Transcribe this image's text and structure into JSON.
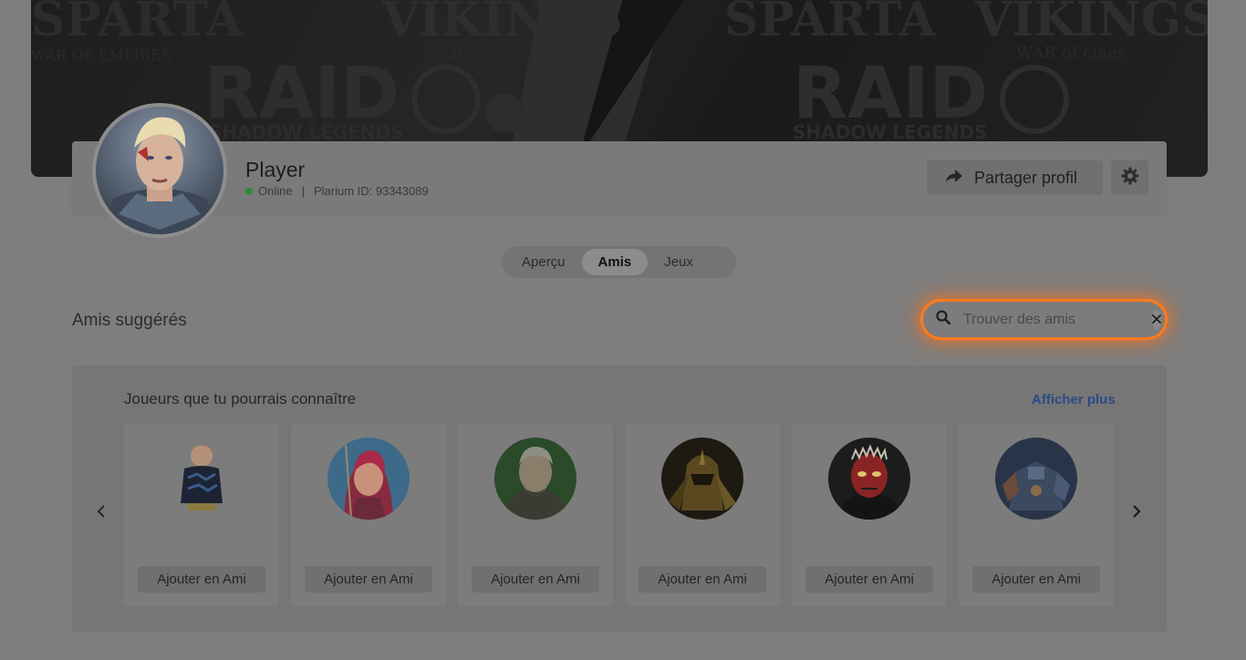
{
  "banner": {
    "texts": [
      "SPARTA",
      "VIKINGS",
      "RAID",
      "SHADOW LEGENDS",
      "WAR OF EMPIRES",
      "WAR of clans"
    ]
  },
  "profile": {
    "name": "Player",
    "status": "Online",
    "separator": "|",
    "id_label": "Plarium ID: 93343089",
    "share_label": "Partager profil",
    "share_icon": "share-arrow-icon",
    "settings_icon": "gear-icon"
  },
  "tabs": [
    {
      "label": "Aperçu",
      "active": false
    },
    {
      "label": "Amis",
      "active": true
    },
    {
      "label": "Jeux",
      "active": false
    }
  ],
  "section": {
    "title": "Amis suggérés"
  },
  "search": {
    "placeholder": "Trouver des amis",
    "value": "",
    "icon": "search-icon",
    "clear_icon": "close-icon",
    "highlight_color": "#ff7a1a"
  },
  "suggestions": {
    "title": "Joueurs que tu pourrais connaître",
    "show_more": "Afficher plus",
    "prev_icon": "chevron-left-icon",
    "next_icon": "chevron-right-icon",
    "cards": [
      {
        "avatar": "child-sweater-avatar",
        "button": "Ajouter en Ami"
      },
      {
        "avatar": "pink-hair-warrior-avatar",
        "button": "Ajouter en Ami"
      },
      {
        "avatar": "old-bearded-man-avatar",
        "button": "Ajouter en Ami"
      },
      {
        "avatar": "gold-helmet-knight-avatar",
        "button": "Ajouter en Ami"
      },
      {
        "avatar": "red-demon-avatar",
        "button": "Ajouter en Ami"
      },
      {
        "avatar": "armored-mech-avatar",
        "button": "Ajouter en Ami"
      }
    ]
  }
}
